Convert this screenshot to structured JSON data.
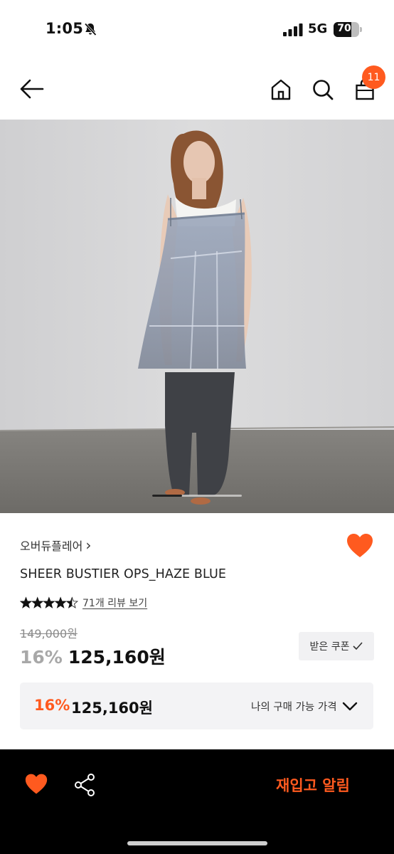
{
  "status_bar": {
    "time": "1:05",
    "network": "5G",
    "battery_level": "70",
    "battery_fraction": 0.7,
    "icons": [
      "bell-slash-icon",
      "signal-bars-icon",
      "battery-icon"
    ]
  },
  "nav": {
    "icons": [
      "back-arrow-icon",
      "home-icon",
      "search-icon",
      "shopping-bag-icon"
    ],
    "cart_count": "11"
  },
  "product": {
    "image_description_icon": "product-photo",
    "carousel": {
      "total": 3,
      "active": 1
    },
    "brand": "오버듀플레어",
    "brand_chevron": "›",
    "name": "SHEER BUSTIER OPS_HAZE BLUE",
    "rating": 4.5,
    "review_link": "71개 리뷰 보기",
    "original_price": "149,000원",
    "discount": "16%",
    "sale_price": "125,160원",
    "coupon_label": "받은 쿠폰",
    "my_price": {
      "discount": "16%",
      "price": "125,160원",
      "label": "나의 구매 가능 가격"
    }
  },
  "bottom_bar": {
    "restock_label": "재입고 알림",
    "icons": [
      "heart-icon",
      "share-icon"
    ]
  },
  "colors": {
    "accent": "#ff5a1f",
    "text": "#111111",
    "muted": "#a8a8a8",
    "panel": "#f3f3f5",
    "bottom_bar": "#000000"
  }
}
